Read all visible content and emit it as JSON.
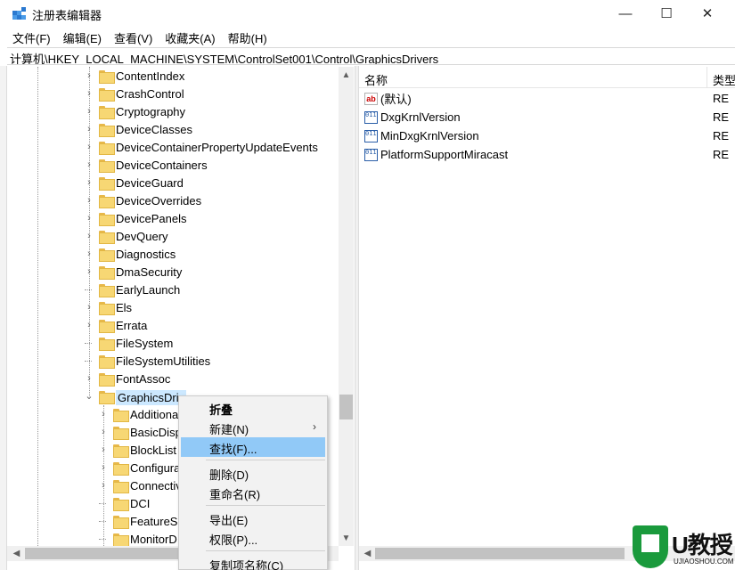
{
  "window": {
    "title": "注册表编辑器",
    "min_glyph": "—",
    "max_glyph": "☐",
    "close_glyph": "✕"
  },
  "menu": [
    "文件(F)",
    "编辑(E)",
    "查看(V)",
    "收藏夹(A)",
    "帮助(H)"
  ],
  "address": "计算机\\HKEY_LOCAL_MACHINE\\SYSTEM\\ControlSet001\\Control\\GraphicsDrivers",
  "tree": {
    "items": [
      {
        "label": "ContentIndex",
        "expander": "chevron-right"
      },
      {
        "label": "CrashControl",
        "expander": "chevron-right"
      },
      {
        "label": "Cryptography",
        "expander": "chevron-right"
      },
      {
        "label": "DeviceClasses",
        "expander": "chevron-right"
      },
      {
        "label": "DeviceContainerPropertyUpdateEvents",
        "expander": "chevron-right"
      },
      {
        "label": "DeviceContainers",
        "expander": "chevron-right"
      },
      {
        "label": "DeviceGuard",
        "expander": "chevron-right"
      },
      {
        "label": "DeviceOverrides",
        "expander": "chevron-right"
      },
      {
        "label": "DevicePanels",
        "expander": "chevron-right"
      },
      {
        "label": "DevQuery",
        "expander": "chevron-right"
      },
      {
        "label": "Diagnostics",
        "expander": "chevron-right"
      },
      {
        "label": "DmaSecurity",
        "expander": "chevron-right"
      },
      {
        "label": "EarlyLaunch",
        "expander": "none"
      },
      {
        "label": "Els",
        "expander": "chevron-right"
      },
      {
        "label": "Errata",
        "expander": "chevron-right"
      },
      {
        "label": "FileSystem",
        "expander": "none"
      },
      {
        "label": "FileSystemUtilities",
        "expander": "none"
      },
      {
        "label": "FontAssoc",
        "expander": "chevron-right"
      },
      {
        "label": "GraphicsDriv",
        "expander": "chevron-down",
        "selected": true
      }
    ],
    "children": [
      {
        "label": "Additiona",
        "expander": "chevron-right"
      },
      {
        "label": "BasicDisp",
        "expander": "chevron-right"
      },
      {
        "label": "BlockList",
        "expander": "chevron-right"
      },
      {
        "label": "Configura",
        "expander": "chevron-right"
      },
      {
        "label": "Connectiv",
        "expander": "chevron-right"
      },
      {
        "label": "DCI",
        "expander": "none"
      },
      {
        "label": "FeatureSe",
        "expander": "none"
      },
      {
        "label": "MonitorD",
        "expander": "none"
      }
    ]
  },
  "values": {
    "header_name": "名称",
    "header_type": "类型",
    "rows": [
      {
        "icon": "string-value-icon",
        "icon_text": "ab",
        "name": "(默认)",
        "type": "RE"
      },
      {
        "icon": "binary-value-icon",
        "icon_text": "011 110",
        "name": "DxgKrnlVersion",
        "type": "RE"
      },
      {
        "icon": "binary-value-icon",
        "icon_text": "011 110",
        "name": "MinDxgKrnlVersion",
        "type": "RE"
      },
      {
        "icon": "binary-value-icon",
        "icon_text": "011 110",
        "name": "PlatformSupportMiracast",
        "type": "RE"
      }
    ]
  },
  "context_menu": {
    "collapse": "折叠",
    "new": "新建(N)",
    "find": "查找(F)...",
    "delete": "删除(D)",
    "rename": "重命名(R)",
    "export": "导出(E)",
    "permissions": "权限(P)...",
    "copy_key_name": "复制项名称(C)"
  },
  "watermark": {
    "brand": "U教授",
    "site": "UJIAOSHOU.COM"
  },
  "colors": {
    "selection": "#cce8ff",
    "menu_highlight": "#91c9f7",
    "folder": "#f7d774",
    "watermark_green": "#1a9a3c"
  }
}
